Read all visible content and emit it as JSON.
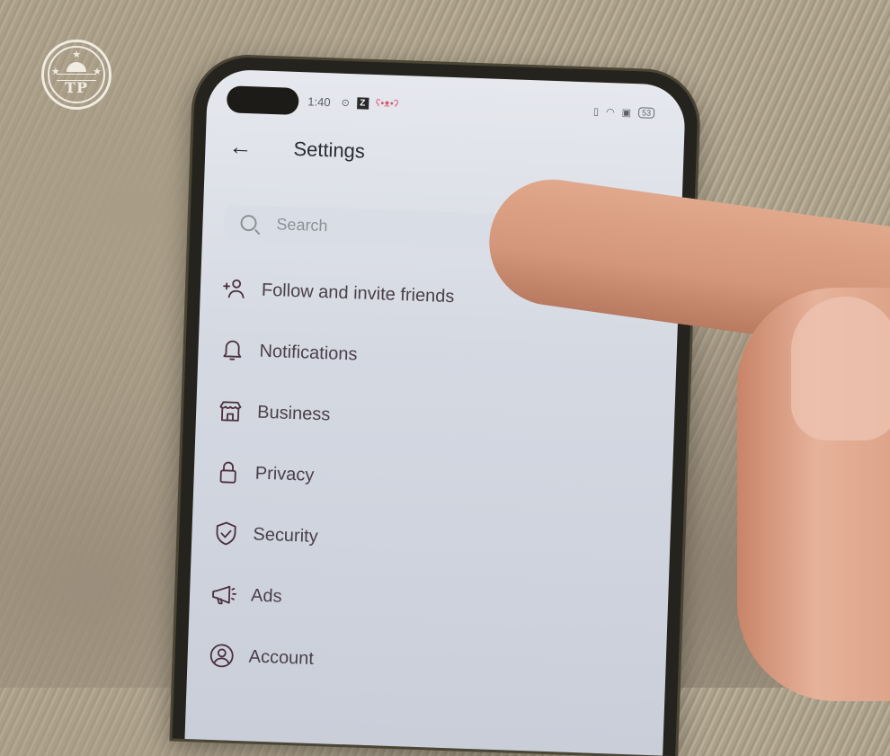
{
  "watermark": {
    "text": "TP",
    "stars": 3
  },
  "status_bar": {
    "time": "1:40",
    "left_icons": [
      "record-icon",
      "z-app-icon",
      "panda-app-icon"
    ],
    "right_icons": [
      "vibrate-icon",
      "wifi-icon",
      "cast-icon"
    ],
    "battery": "53"
  },
  "header": {
    "back_icon": "back-arrow-icon",
    "title": "Settings"
  },
  "search": {
    "placeholder": "Search"
  },
  "menu": [
    {
      "icon": "add-person-icon",
      "label": "Follow and invite friends"
    },
    {
      "icon": "bell-icon",
      "label": "Notifications"
    },
    {
      "icon": "store-icon",
      "label": "Business"
    },
    {
      "icon": "lock-icon",
      "label": "Privacy"
    },
    {
      "icon": "shield-check-icon",
      "label": "Security"
    },
    {
      "icon": "megaphone-icon",
      "label": "Ads"
    },
    {
      "icon": "account-circle-icon",
      "label": "Account"
    }
  ]
}
